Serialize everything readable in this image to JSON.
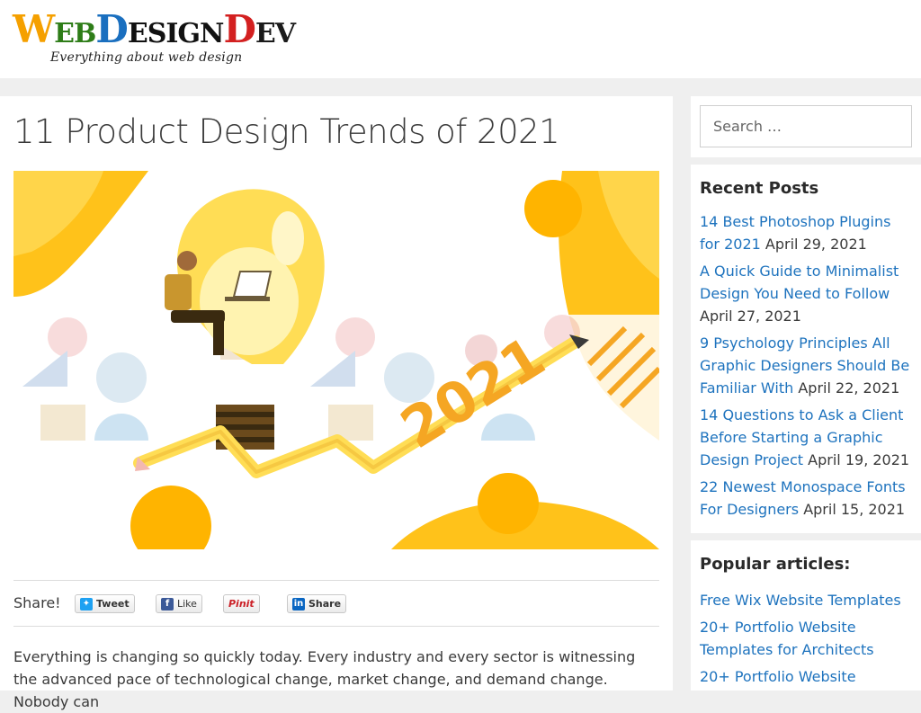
{
  "header": {
    "logo_letters": [
      "W",
      "EB",
      "D",
      "ESIGN",
      "D",
      "EV"
    ],
    "logo_colors": [
      "#f5a000",
      "#2e7d18",
      "#1a6fbf",
      "#111111",
      "#d32020",
      "#1a1a1a"
    ],
    "tagline": "Everything about web design"
  },
  "post": {
    "title": "11 Product Design Trends of 2021",
    "hero_year": "2021",
    "share_label": "Share!",
    "share_buttons": [
      "Tweet",
      "Like",
      "Pinit",
      "Share"
    ],
    "body": "Everything is changing so quickly today. Every industry and every sector is witnessing the advanced pace of technological change, market change, and demand change. Nobody can"
  },
  "sidebar": {
    "search_placeholder": "Search …",
    "recent_title": "Recent Posts",
    "recent_posts": [
      {
        "title": "14 Best Photoshop Plugins for 2021",
        "date": "April 29, 2021"
      },
      {
        "title": "A Quick Guide to Minimalist Design You Need to Follow",
        "date": "April 27, 2021"
      },
      {
        "title": "9 Psychology Principles All Graphic Designers Should Be Familiar With",
        "date": "April 22, 2021"
      },
      {
        "title": "14 Questions to Ask a Client Before Starting a Graphic Design Project",
        "date": "April 19, 2021"
      },
      {
        "title": "22 Newest Monospace Fonts For Designers",
        "date": "April 15, 2021"
      }
    ],
    "popular_title": "Popular articles:",
    "popular_posts": [
      "Free Wix Website Templates",
      "20+ Portfolio Website Templates for Architects",
      "20+ Portfolio Website"
    ]
  },
  "colors": {
    "link": "#1e73be",
    "accent_yellow": "#f7b500",
    "twitter": "#1da1f2",
    "facebook": "#3b5998",
    "pinterest": "#cb2027",
    "linkedin": "#0a66c2"
  },
  "icons": {
    "tweet": "twitter-bird-icon",
    "like": "facebook-f-icon",
    "pin": "pinterest-p-icon",
    "share": "linkedin-in-icon"
  }
}
